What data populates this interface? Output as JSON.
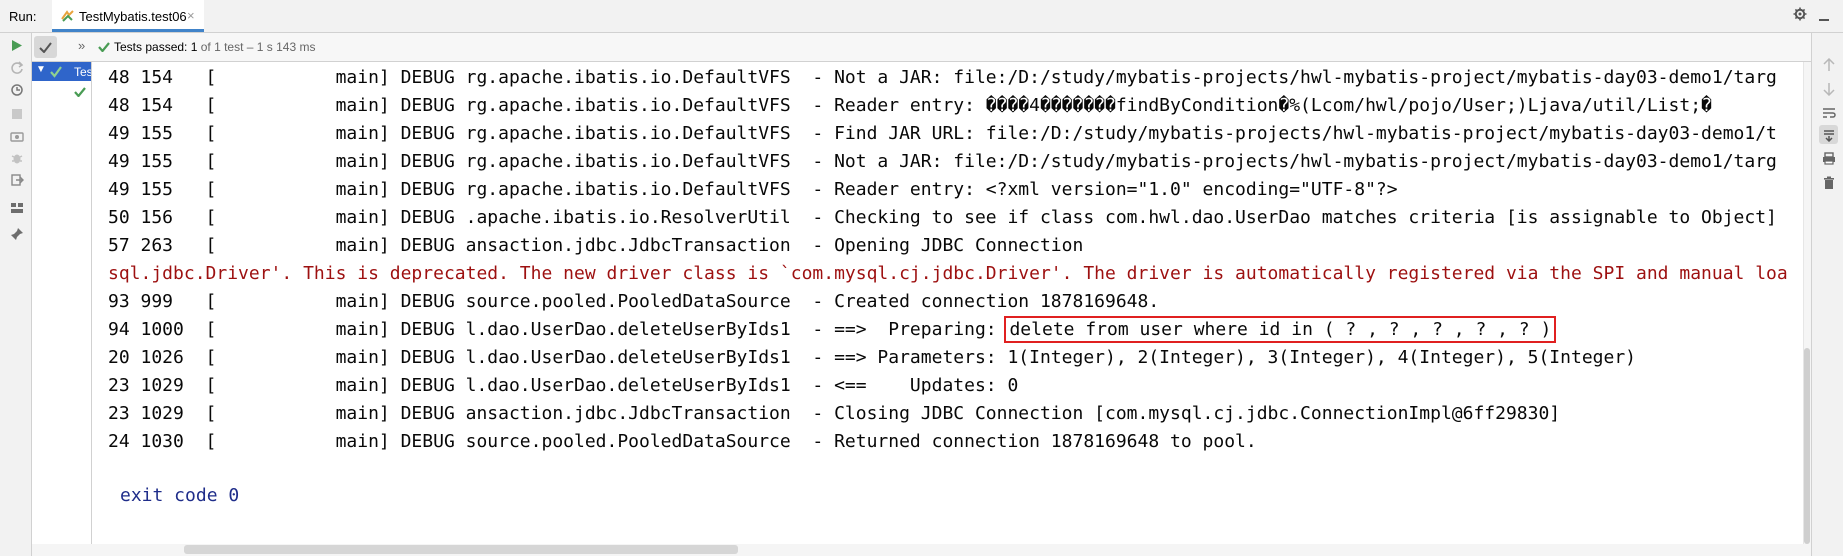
{
  "window": {
    "run_label": "Run:",
    "tab_title": "TestMybatis.test06",
    "tab_close": "×"
  },
  "test_toolbar": {
    "expand_glyph": "»",
    "passed_text": "Tests passed: ",
    "passed_count": "1",
    "detail": " of 1 test – 1 s 143 ms"
  },
  "tree": {
    "root_label": "Tes"
  },
  "console": {
    "lines": [
      "48 154   [           main] DEBUG rg.apache.ibatis.io.DefaultVFS  - Not a JAR: file:/D:/study/mybatis-projects/hwl-mybatis-project/mybatis-day03-demo1/targ",
      "48 154   [           main] DEBUG rg.apache.ibatis.io.DefaultVFS  - Reader entry: ����4�������findByCondition�%(Lcom/hwl/pojo/User;)Ljava/util/List;�",
      "49 155   [           main] DEBUG rg.apache.ibatis.io.DefaultVFS  - Find JAR URL: file:/D:/study/mybatis-projects/hwl-mybatis-project/mybatis-day03-demo1/t",
      "49 155   [           main] DEBUG rg.apache.ibatis.io.DefaultVFS  - Not a JAR: file:/D:/study/mybatis-projects/hwl-mybatis-project/mybatis-day03-demo1/targ",
      "49 155   [           main] DEBUG rg.apache.ibatis.io.DefaultVFS  - Reader entry: <?xml version=\"1.0\" encoding=\"UTF-8\"?>",
      "50 156   [           main] DEBUG .apache.ibatis.io.ResolverUtil  - Checking to see if class com.hwl.dao.UserDao matches criteria [is assignable to Object]",
      "57 263   [           main] DEBUG ansaction.jdbc.JdbcTransaction  - Opening JDBC Connection",
      "sql.jdbc.Driver'. This is deprecated. The new driver class is `com.mysql.cj.jdbc.Driver'. The driver is automatically registered via the SPI and manual loa",
      "93 999   [           main] DEBUG source.pooled.PooledDataSource  - Created connection 1878169648.",
      "94 1000  [           main] DEBUG l.dao.UserDao.deleteUserByIds1  - ==>  Preparing: ",
      "20 1026  [           main] DEBUG l.dao.UserDao.deleteUserByIds1  - ==> Parameters: 1(Integer), 2(Integer), 3(Integer), 4(Integer), 5(Integer)",
      "23 1029  [           main] DEBUG l.dao.UserDao.deleteUserByIds1  - <==    Updates: 0",
      "23 1029  [           main] DEBUG ansaction.jdbc.JdbcTransaction  - Closing JDBC Connection [com.mysql.cj.jdbc.ConnectionImpl@6ff29830]",
      "24 1030  [           main] DEBUG source.pooled.PooledDataSource  - Returned connection 1878169648 to pool."
    ],
    "highlighted_sql": "delete from user where id in ( ? , ? , ? , ? , ? )",
    "exit_line": "exit code 0"
  },
  "colors": {
    "accent_tab": "#4083c9",
    "pass_green": "#499c54",
    "error_red": "#9d1010",
    "highlight_box": "#e02020",
    "selection_blue": "#2f65ca"
  },
  "icons": {
    "tab": "junit-tab-icon",
    "rerun": "run-icon",
    "passed": "check-icon",
    "settings": "gear-icon",
    "minimize": "minimize-icon"
  }
}
